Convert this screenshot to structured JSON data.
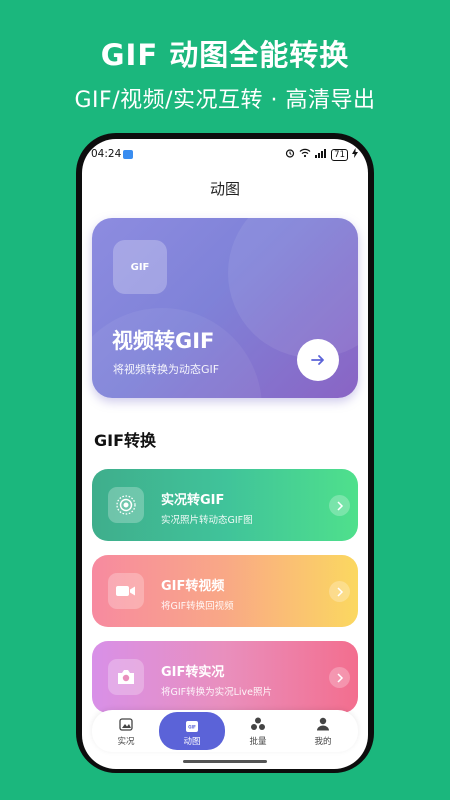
{
  "promo": {
    "title": "GIF 动图全能转换",
    "subtitle": "GIF/视频/实况互转 · 高清导出"
  },
  "status_bar": {
    "time": "04:24",
    "battery": "71"
  },
  "nav": {
    "title": "动图"
  },
  "hero": {
    "badge": "GIF",
    "title": "视频转GIF",
    "subtitle": "将视频转换为动态GIF"
  },
  "section": {
    "title": "GIF转换"
  },
  "features": [
    {
      "title": "实况转GIF",
      "subtitle": "实况照片转动态GIF图",
      "icon": "live-photo-icon"
    },
    {
      "title": "GIF转视频",
      "subtitle": "将GIF转换回视频",
      "icon": "video-camera-icon"
    },
    {
      "title": "GIF转实况",
      "subtitle": "将GIF转换为实况Live照片",
      "icon": "camera-icon"
    }
  ],
  "tabs": [
    {
      "label": "实况",
      "icon": "image-icon",
      "active": false
    },
    {
      "label": "动图",
      "icon": "gif-icon",
      "active": true
    },
    {
      "label": "批量",
      "icon": "batch-icon",
      "active": false
    },
    {
      "label": "我的",
      "icon": "user-icon",
      "active": false
    }
  ],
  "colors": {
    "background": "#1bb77d",
    "accent": "#5b63d8",
    "hero_gradient_start": "#8d8ce0",
    "hero_gradient_end": "#8a64c4"
  }
}
